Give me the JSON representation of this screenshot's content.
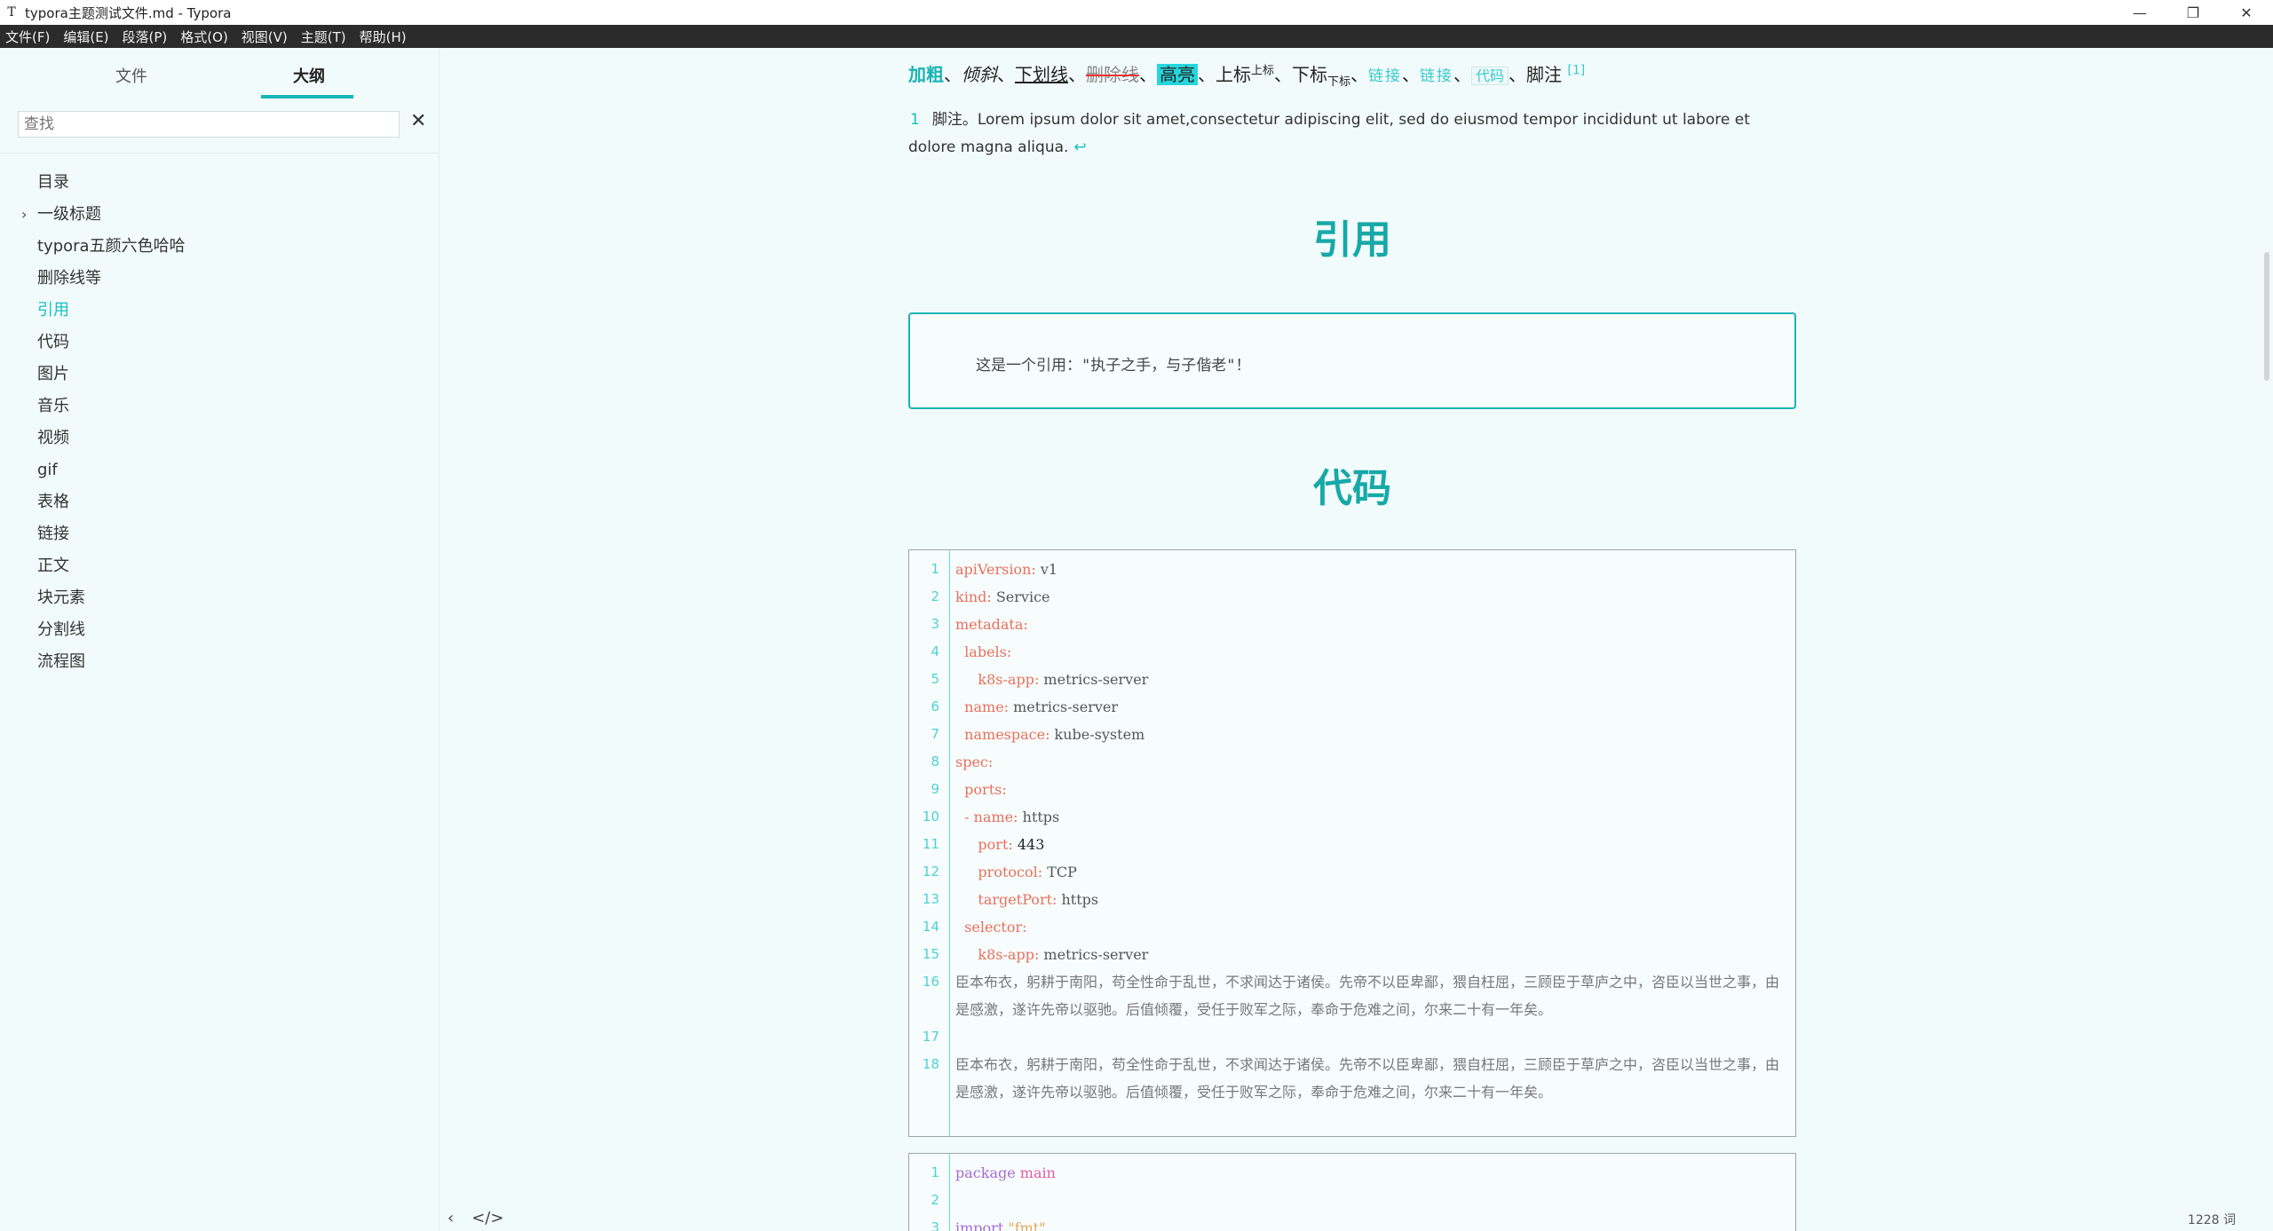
{
  "window": {
    "app_icon": "T",
    "title": "typora主题测试文件.md - Typora",
    "controls": {
      "minimize": "—",
      "maximize": "❐",
      "close": "✕"
    }
  },
  "menubar": {
    "items": [
      "文件(F)",
      "编辑(E)",
      "段落(P)",
      "格式(O)",
      "视图(V)",
      "主题(T)",
      "帮助(H)"
    ]
  },
  "sidebar": {
    "tabs": [
      "文件",
      "大纲"
    ],
    "active_tab": "大纲",
    "search_placeholder": "查找",
    "clear_icon": "✕",
    "outline": [
      {
        "label": "目录"
      },
      {
        "label": "一级标题",
        "caret": "›"
      },
      {
        "label": "typora五颜六色哈哈"
      },
      {
        "label": "删除线等"
      },
      {
        "label": "引用",
        "active": true
      },
      {
        "label": "代码"
      },
      {
        "label": "图片"
      },
      {
        "label": "音乐"
      },
      {
        "label": "视频"
      },
      {
        "label": "gif"
      },
      {
        "label": "表格"
      },
      {
        "label": "链接"
      },
      {
        "label": "正文"
      },
      {
        "label": "块元素"
      },
      {
        "label": "分割线"
      },
      {
        "label": "流程图"
      }
    ]
  },
  "inline": {
    "bold": "加粗",
    "sep": "、",
    "italic": "倾斜",
    "underline": "下划线",
    "strike": "删除线",
    "highlight": "高亮",
    "sup_base": "上标",
    "sup": "上标",
    "sub_base": "下标",
    "sub": "下标",
    "link1": "链接",
    "link2": "链接",
    "code": "代码",
    "footnote": "脚注",
    "fnref": "[1]"
  },
  "footnote": {
    "number": "1",
    "text": "脚注。Lorem ipsum dolor sit amet,consectetur adipiscing elit, sed do eiusmod tempor incididunt ut labore et dolore magna aliqua.",
    "back": "↩"
  },
  "headings": {
    "quote": "引用",
    "code": "代码"
  },
  "blockquote": {
    "text": "这是一个引用：\"执子之手，与子偕老\"！"
  },
  "codeblock1": {
    "lines": [
      {
        "n": "1",
        "k": "apiVersion:",
        "v": " v1"
      },
      {
        "n": "2",
        "k": "kind:",
        "v": " Service"
      },
      {
        "n": "3",
        "k": "metadata:",
        "v": ""
      },
      {
        "n": "4",
        "k": "  labels:",
        "v": ""
      },
      {
        "n": "5",
        "k": "     k8s-app:",
        "v": " metrics-server"
      },
      {
        "n": "6",
        "k": "  name:",
        "v": " metrics-server"
      },
      {
        "n": "7",
        "k": "  namespace:",
        "v": " kube-system"
      },
      {
        "n": "8",
        "k": "spec:",
        "v": ""
      },
      {
        "n": "9",
        "k": "  ports:",
        "v": ""
      },
      {
        "n": "10",
        "k": "  - name:",
        "v": " https"
      },
      {
        "n": "11",
        "k": "     port:",
        "v": " 443"
      },
      {
        "n": "12",
        "k": "     protocol:",
        "v": " TCP"
      },
      {
        "n": "13",
        "k": "     targetPort:",
        "v": " https"
      },
      {
        "n": "14",
        "k": "  selector:",
        "v": ""
      },
      {
        "n": "15",
        "k": "     k8s-app:",
        "v": " metrics-server"
      }
    ],
    "prose_16": "臣本布衣，躬耕于南阳，苟全性命于乱世，不求闻达于诸侯。先帝不以臣卑鄙，猥自枉屈，三顾臣于草庐之中，咨臣以当世之事，由是感激，遂许先帝以驱驰。后值倾覆，受任于败军之际，奉命于危难之间，尔来二十有一年矣。",
    "prose_18": "臣本布衣，躬耕于南阳，苟全性命于乱世，不求闻达于诸侯。先帝不以臣卑鄙，猥自枉屈，三顾臣于草庐之中，咨臣以当世之事，由是感激，遂许先帝以驱驰。后值倾覆，受任于败军之际，奉命于危难之间，尔来二十有一年矣。",
    "ln16": "16",
    "ln17": "17",
    "ln18": "18"
  },
  "codeblock2": {
    "l1_kw": "package",
    "l1_name": " main",
    "l3_kw": "import",
    "l3_str": " \"fmt\""
  },
  "footer": {
    "sidebar_toggle": "‹",
    "source_toggle": "</>",
    "wordcount": "1228 词"
  }
}
